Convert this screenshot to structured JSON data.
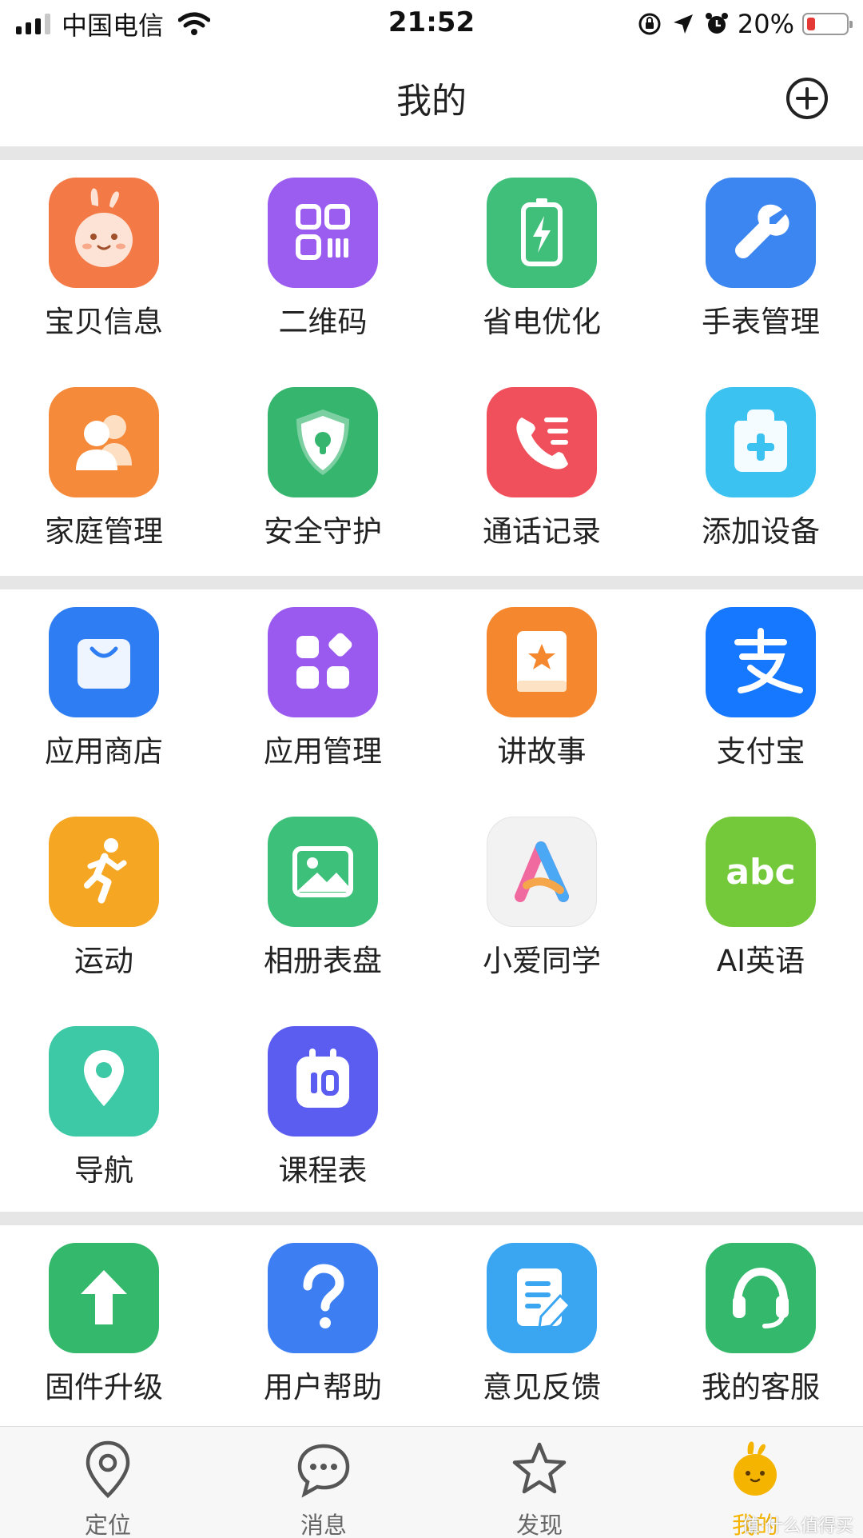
{
  "status_bar": {
    "carrier": "中国电信",
    "time": "21:52",
    "battery_percent": "20%",
    "battery_level": 0.2,
    "icons": [
      "signal-icon",
      "wifi-icon",
      "orientation-lock-icon",
      "location-arrow-icon",
      "alarm-icon",
      "battery-icon"
    ]
  },
  "header": {
    "title": "我的",
    "add_icon": "plus-circle-icon"
  },
  "sections": [
    {
      "items": [
        {
          "label": "宝贝信息",
          "icon": "bunny-face-icon",
          "color": "#f37a46"
        },
        {
          "label": "二维码",
          "icon": "qr-code-icon",
          "color": "#9b5cf0"
        },
        {
          "label": "省电优化",
          "icon": "battery-charge-icon",
          "color": "#3fbf7a"
        },
        {
          "label": "手表管理",
          "icon": "wrench-icon",
          "color": "#3b86f0"
        },
        {
          "label": "家庭管理",
          "icon": "family-users-icon",
          "color": "#f58a3a"
        },
        {
          "label": "安全守护",
          "icon": "shield-icon",
          "color": "#35b56e"
        },
        {
          "label": "通话记录",
          "icon": "phone-log-icon",
          "color": "#f0505c"
        },
        {
          "label": "添加设备",
          "icon": "add-device-icon",
          "color": "#3cc2f0"
        }
      ]
    },
    {
      "items": [
        {
          "label": "应用商店",
          "icon": "shopping-bag-icon",
          "color": "#2f7df2"
        },
        {
          "label": "应用管理",
          "icon": "app-grid-icon",
          "color": "#9a5af0"
        },
        {
          "label": "讲故事",
          "icon": "story-book-icon",
          "color": "#f5882e"
        },
        {
          "label": "支付宝",
          "icon": "alipay-icon",
          "color": "#1677ff"
        },
        {
          "label": "运动",
          "icon": "runner-icon",
          "color": "#f5a623"
        },
        {
          "label": "相册表盘",
          "icon": "photo-album-icon",
          "color": "#3cc07a"
        },
        {
          "label": "小爱同学",
          "icon": "xiaoai-icon",
          "color": "#f2f2f2"
        },
        {
          "label": "AI英语",
          "icon": "abc-icon",
          "color": "#74c93a"
        },
        {
          "label": "导航",
          "icon": "map-pin-icon",
          "color": "#3dc9a6"
        },
        {
          "label": "课程表",
          "icon": "schedule-icon",
          "color": "#5b5cf0"
        }
      ]
    },
    {
      "items": [
        {
          "label": "固件升级",
          "icon": "upgrade-arrow-icon",
          "color": "#34b86b"
        },
        {
          "label": "用户帮助",
          "icon": "help-question-icon",
          "color": "#3d7ff2"
        },
        {
          "label": "意见反馈",
          "icon": "feedback-edit-icon",
          "color": "#3aa6f2"
        },
        {
          "label": "我的客服",
          "icon": "headset-icon",
          "color": "#34b86b"
        }
      ]
    }
  ],
  "tab_bar": {
    "tabs": [
      {
        "label": "定位",
        "icon": "location-pin-icon"
      },
      {
        "label": "消息",
        "icon": "chat-bubble-icon"
      },
      {
        "label": "发现",
        "icon": "star-icon"
      },
      {
        "label": "我的",
        "icon": "mascot-icon",
        "active": true
      }
    ]
  },
  "watermark": "值·什么值得买"
}
